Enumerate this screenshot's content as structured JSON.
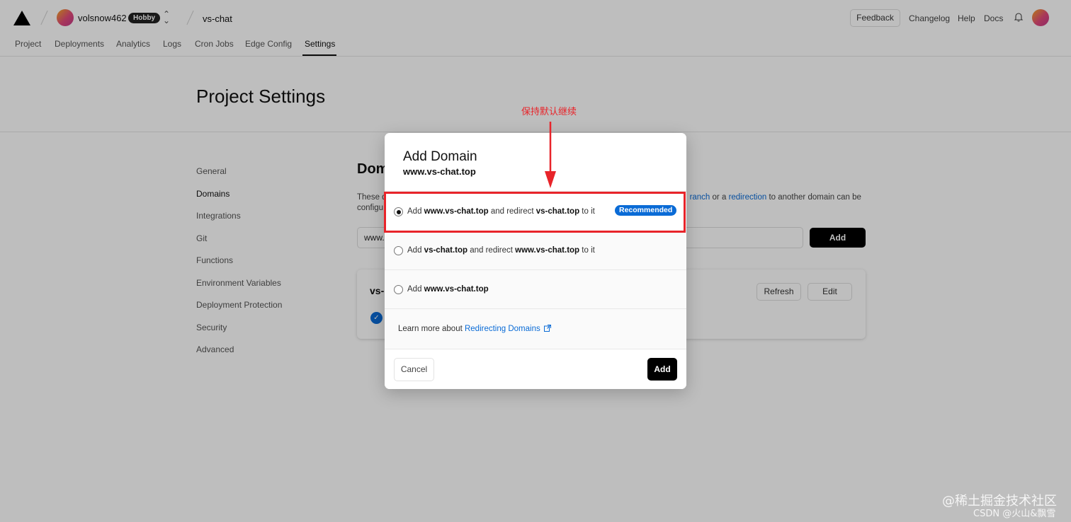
{
  "header": {
    "team_name": "volsnow462",
    "plan_badge": "Hobby",
    "project_name": "vs-chat",
    "feedback_label": "Feedback",
    "links": [
      "Changelog",
      "Help",
      "Docs"
    ]
  },
  "tabs": [
    "Project",
    "Deployments",
    "Analytics",
    "Logs",
    "Cron Jobs",
    "Edge Config",
    "Settings"
  ],
  "active_tab": "Settings",
  "page_title": "Project Settings",
  "sidebar": {
    "items": [
      "General",
      "Domains",
      "Integrations",
      "Git",
      "Functions",
      "Environment Variables",
      "Deployment Protection",
      "Security",
      "Advanced"
    ],
    "active": "Domains"
  },
  "domains_section": {
    "title_visible": "Dom",
    "desc_line1_start": "These d",
    "desc_line1_link1": "ranch",
    "desc_line1_mid": " or a ",
    "desc_line1_link2": "redirection",
    "desc_line1_end": " to another domain can be",
    "desc_line2_start": "configu",
    "input_value_visible": "www.",
    "add_label": "Add",
    "card_domain_visible": "vs-",
    "refresh_label": "Refresh",
    "edit_label": "Edit"
  },
  "modal": {
    "title": "Add Domain",
    "subtitle": "www.vs-chat.top",
    "options": [
      {
        "pre": "Add ",
        "b1": "www.vs-chat.top",
        "mid": " and redirect ",
        "b2": "vs-chat.top",
        "post": " to it",
        "selected": true,
        "badge": "Recommended"
      },
      {
        "pre": "Add ",
        "b1": "vs-chat.top",
        "mid": " and redirect ",
        "b2": "www.vs-chat.top",
        "post": " to it",
        "selected": false
      },
      {
        "pre": "Add ",
        "b1": "www.vs-chat.top",
        "mid": "",
        "b2": "",
        "post": "",
        "selected": false
      }
    ],
    "learn_prefix": "Learn more about ",
    "learn_link": "Redirecting Domains",
    "cancel_label": "Cancel",
    "add_label": "Add"
  },
  "annotation": {
    "text": "保持默认继续",
    "color": "#e8242a"
  },
  "watermark": {
    "line1": "@稀土掘金技术社区",
    "line2": "CSDN @火山&飘雪"
  },
  "colors": {
    "accent": "#0a6bd6",
    "primary_button": "#000000",
    "annotation": "#e8242a"
  }
}
